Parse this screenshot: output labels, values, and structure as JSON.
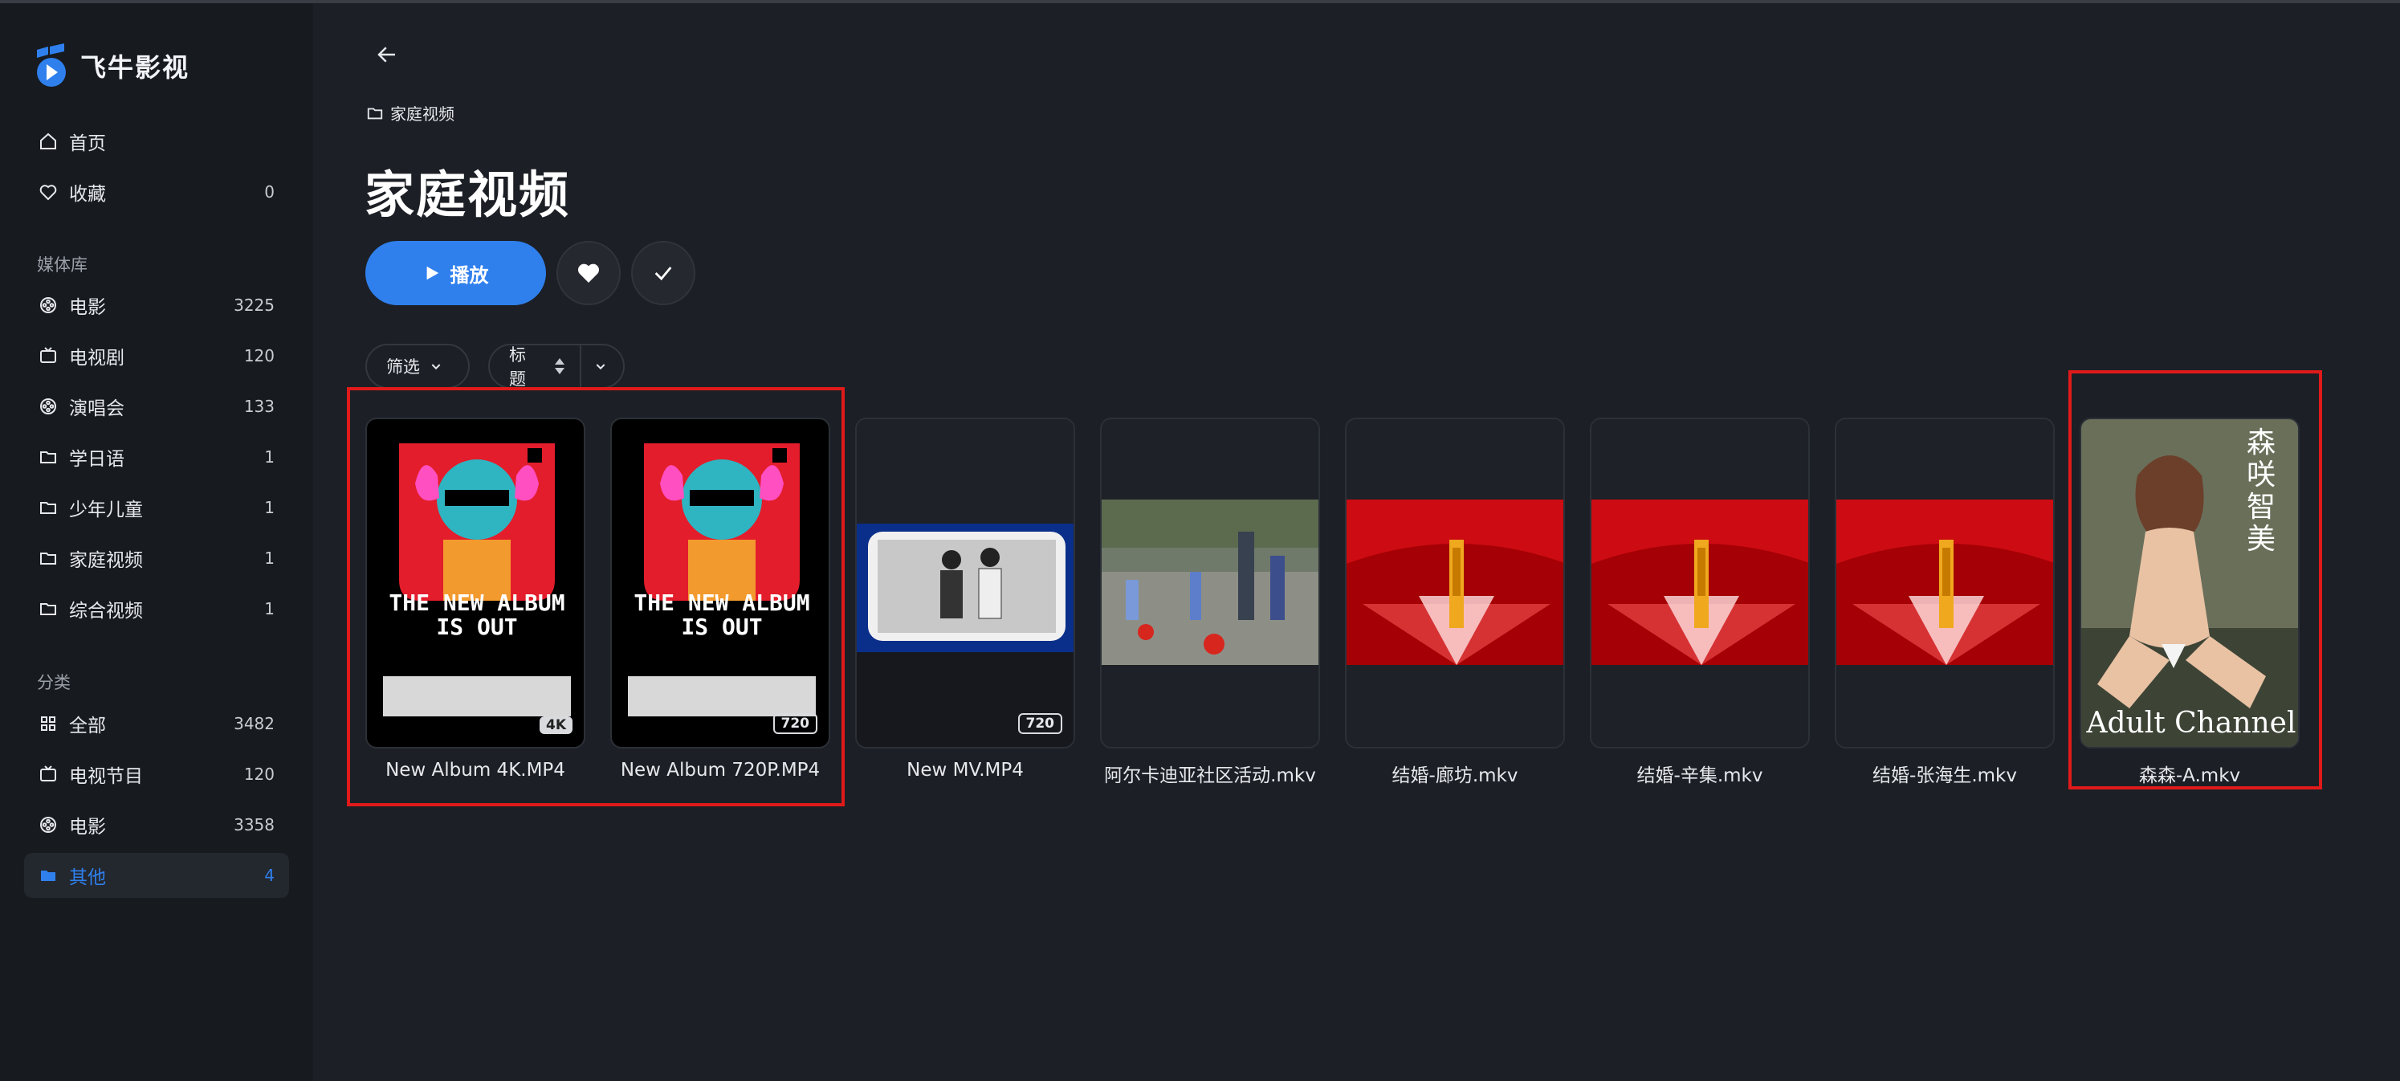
{
  "app": {
    "title": "飞牛影视"
  },
  "nav": {
    "home": "首页",
    "favorites": {
      "label": "收藏",
      "count": "0"
    }
  },
  "library": {
    "title": "媒体库",
    "items": [
      {
        "label": "电影",
        "count": "3225",
        "icon": "film-reel-icon"
      },
      {
        "label": "电视剧",
        "count": "120",
        "icon": "tv-icon"
      },
      {
        "label": "演唱会",
        "count": "133",
        "icon": "film-reel-icon"
      },
      {
        "label": "学日语",
        "count": "1",
        "icon": "folder-icon"
      },
      {
        "label": "少年儿童",
        "count": "1",
        "icon": "folder-icon"
      },
      {
        "label": "家庭视频",
        "count": "1",
        "icon": "folder-icon"
      },
      {
        "label": "综合视频",
        "count": "1",
        "icon": "folder-icon"
      }
    ]
  },
  "categories": {
    "title": "分类",
    "items": [
      {
        "label": "全部",
        "count": "3482",
        "icon": "grid-icon"
      },
      {
        "label": "电视节目",
        "count": "120",
        "icon": "tv-icon"
      },
      {
        "label": "电影",
        "count": "3358",
        "icon": "film-reel-icon"
      },
      {
        "label": "其他",
        "count": "4",
        "icon": "folder-filled-icon",
        "active": true
      }
    ]
  },
  "main": {
    "breadcrumb": "家庭视频",
    "title": "家庭视频",
    "play_label": "播放",
    "filter_label": "筛选",
    "sort_label": "标题"
  },
  "poster": {
    "album_text_1": "THE NEW ALBUM",
    "album_text_2": "IS OUT",
    "adult_channel": "Adult Channel",
    "jp_title": "森咲智美"
  },
  "videos": [
    {
      "title": "New Album 4K.MP4",
      "badge": "4K",
      "badge_style": "solid",
      "thumb": "album"
    },
    {
      "title": "New Album 720P.MP4",
      "badge": "720",
      "badge_style": "outline",
      "thumb": "album"
    },
    {
      "title": "New MV.MP4",
      "badge": "720",
      "badge_style": "outline",
      "thumb": "bw-photo"
    },
    {
      "title": "阿尔卡迪亚社区活动.mkv",
      "badge": "",
      "thumb": "community"
    },
    {
      "title": "结婚-廊坊.mkv",
      "badge": "",
      "thumb": "wedding"
    },
    {
      "title": "结婚-辛集.mkv",
      "badge": "",
      "thumb": "wedding"
    },
    {
      "title": "结婚-张海生.mkv",
      "badge": "",
      "thumb": "wedding"
    },
    {
      "title": "森森-A.mkv",
      "badge": "",
      "thumb": "portrait"
    }
  ],
  "colors": {
    "accent": "#2f80ed",
    "highlight": "#e01a1a"
  }
}
